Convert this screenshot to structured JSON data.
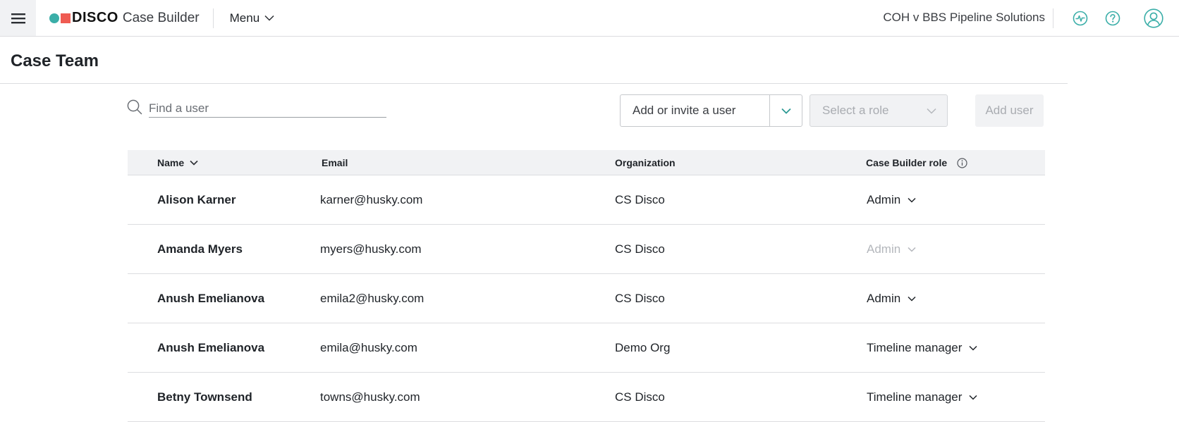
{
  "app": {
    "brand": "DISCO",
    "product": "Case Builder",
    "menu_label": "Menu",
    "case_name": "COH v BBS Pipeline Solutions"
  },
  "page": {
    "title": "Case Team"
  },
  "search": {
    "placeholder": "Find a user",
    "value": ""
  },
  "add_user": {
    "invite_label": "Add or invite a user",
    "role_placeholder": "Select a role",
    "button_label": "Add user"
  },
  "table": {
    "columns": {
      "name": "Name",
      "email": "Email",
      "organization": "Organization",
      "role": "Case Builder role"
    },
    "rows": [
      {
        "name": "Alison Karner",
        "email": "karner@husky.com",
        "organization": "CS Disco",
        "role": "Admin",
        "role_enabled": true
      },
      {
        "name": "Amanda Myers",
        "email": "myers@husky.com",
        "organization": "CS Disco",
        "role": "Admin",
        "role_enabled": false
      },
      {
        "name": "Anush Emelianova",
        "email": "emila2@husky.com",
        "organization": "CS Disco",
        "role": "Admin",
        "role_enabled": true
      },
      {
        "name": "Anush Emelianova",
        "email": "emila@husky.com",
        "organization": "Demo Org",
        "role": "Timeline manager",
        "role_enabled": true
      },
      {
        "name": "Betny Townsend",
        "email": "towns@husky.com",
        "organization": "CS Disco",
        "role": "Timeline manager",
        "role_enabled": true
      }
    ]
  },
  "colors": {
    "accent_teal": "#3aaea8",
    "brand_red": "#ef5b52",
    "header_bg": "#f1f2f4",
    "divider": "#dcdde0"
  },
  "icons": {
    "hamburger": "menu-icon",
    "activity": "activity-icon",
    "help": "help-icon",
    "account": "user-avatar-icon",
    "search": "search-icon",
    "info": "info-icon"
  }
}
